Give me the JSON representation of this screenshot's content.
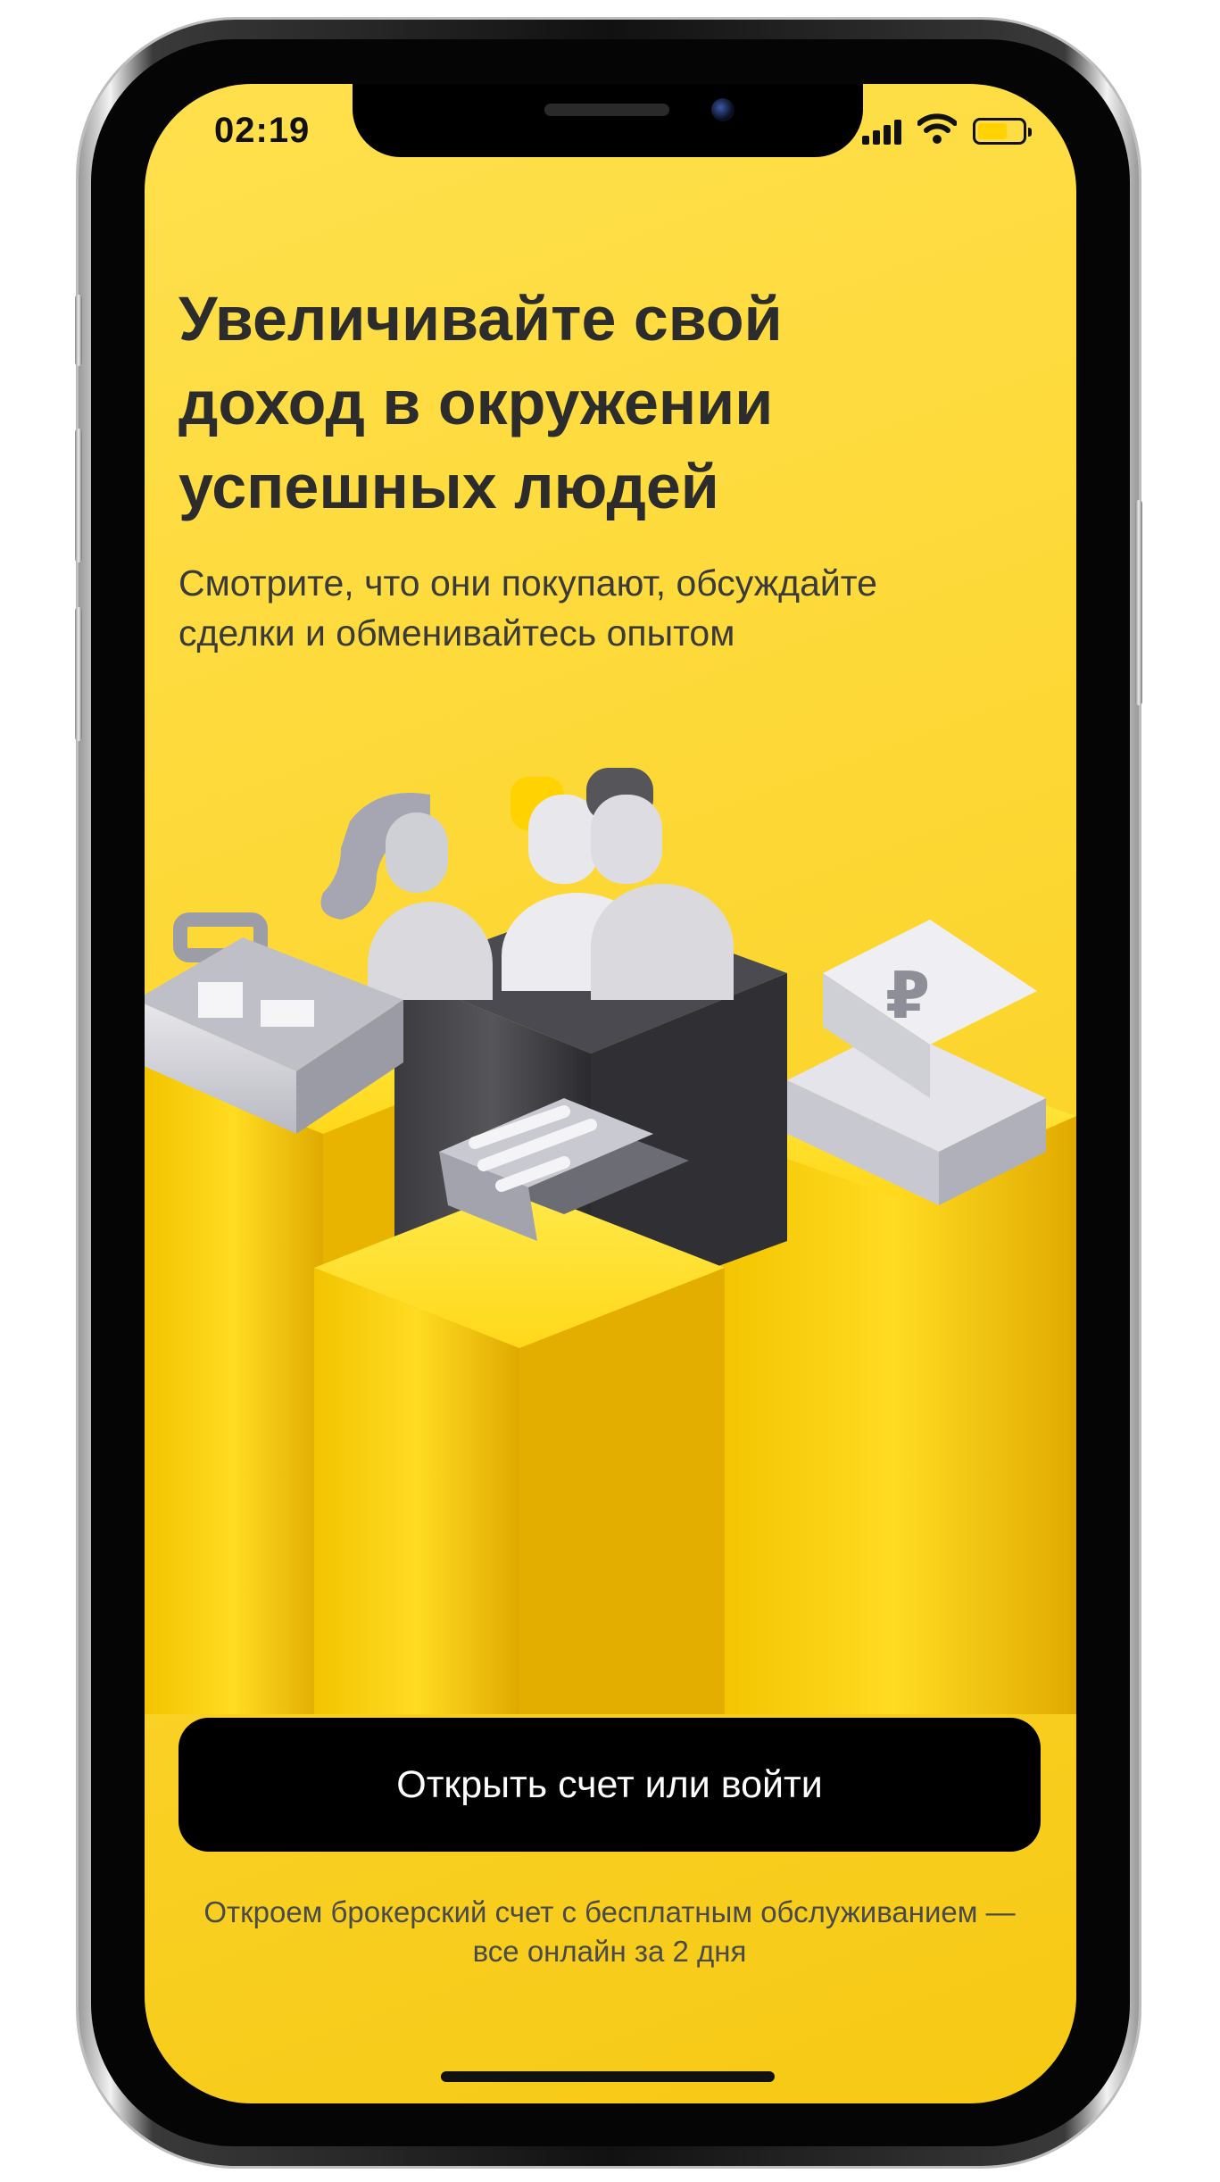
{
  "status_bar": {
    "time": "02:19"
  },
  "onboarding": {
    "headline": "Увеличивайте свой доход в окружении успешных людей",
    "subtitle": "Смотрите, что они покупают, обсуждайте сделки и обменивайтесь опытом",
    "illustration_icons": [
      "people-icon",
      "briefcase-icon",
      "chat-icon",
      "ruble-cash-icon"
    ],
    "primary_button_label": "Открыть счет или войти",
    "footnote": "Откроем брокерский счет с бесплатным обслуживанием — все онлайн за 2 дня"
  },
  "colors": {
    "background": "#fdd835",
    "button": "#000000",
    "button_text": "#ffffff",
    "headline": "#2c2c2c"
  }
}
